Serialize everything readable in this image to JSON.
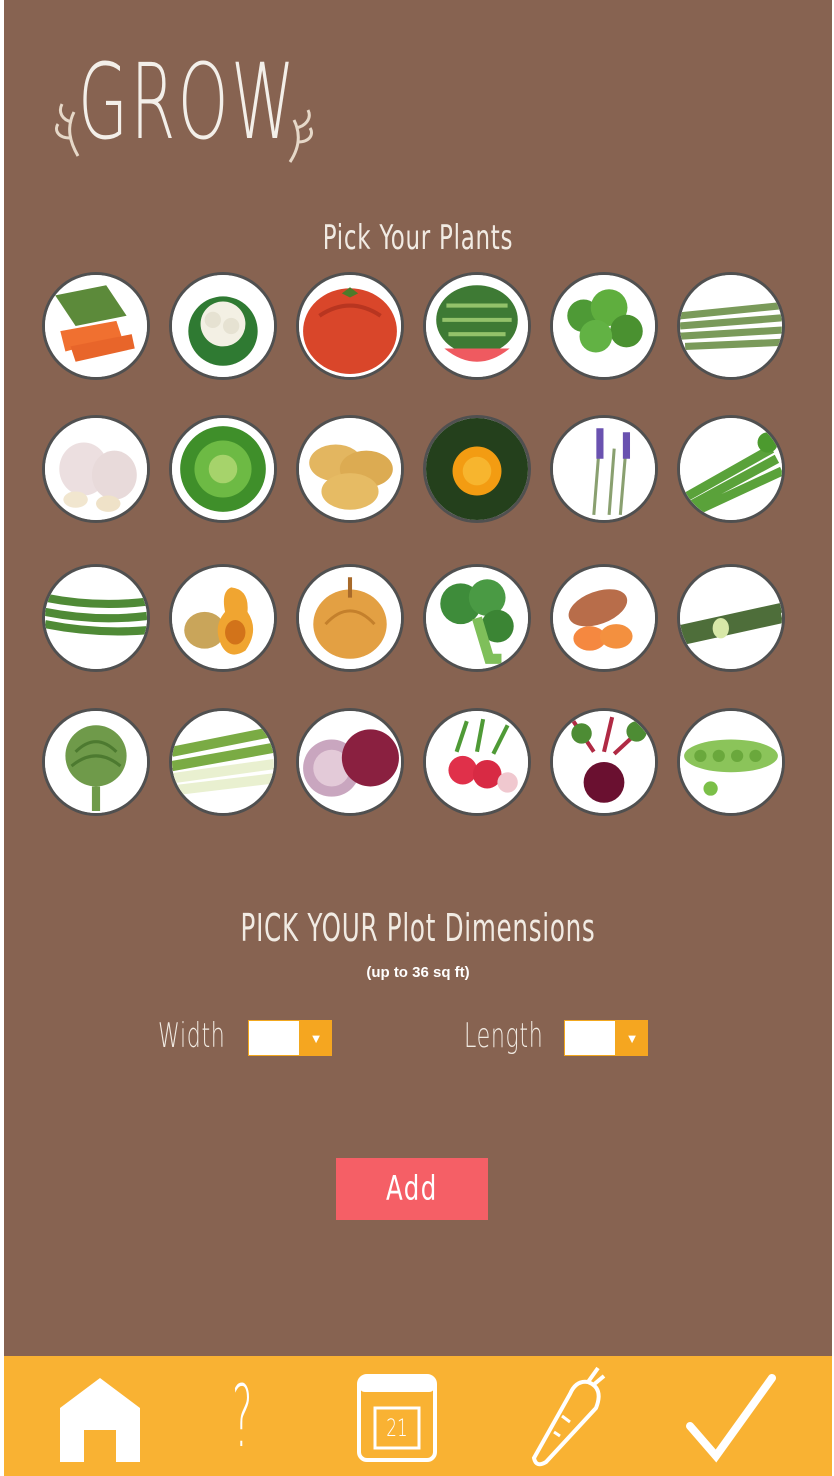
{
  "app": {
    "title": "GROW"
  },
  "plants_section": {
    "title": "Pick Your Plants",
    "plants": [
      {
        "name": "carrot",
        "icon": "carrot-photo"
      },
      {
        "name": "cauliflower",
        "icon": "cauliflower-photo"
      },
      {
        "name": "tomato",
        "icon": "tomato-photo"
      },
      {
        "name": "watermelon",
        "icon": "watermelon-photo"
      },
      {
        "name": "parsley",
        "icon": "parsley-photo"
      },
      {
        "name": "asparagus",
        "icon": "asparagus-photo"
      },
      {
        "name": "garlic",
        "icon": "garlic-photo"
      },
      {
        "name": "lettuce",
        "icon": "lettuce-photo"
      },
      {
        "name": "potato",
        "icon": "potato-photo"
      },
      {
        "name": "marigold",
        "icon": "marigold-photo"
      },
      {
        "name": "lavender",
        "icon": "lavender-photo"
      },
      {
        "name": "celery",
        "icon": "celery-photo"
      },
      {
        "name": "green-beans",
        "icon": "green-beans-photo"
      },
      {
        "name": "butternut-squash",
        "icon": "squash-photo"
      },
      {
        "name": "onion",
        "icon": "onion-photo"
      },
      {
        "name": "broccoli",
        "icon": "broccoli-photo"
      },
      {
        "name": "sweet-potato",
        "icon": "sweet-potato-photo"
      },
      {
        "name": "zucchini",
        "icon": "zucchini-photo"
      },
      {
        "name": "artichoke",
        "icon": "artichoke-photo"
      },
      {
        "name": "leek",
        "icon": "leek-photo"
      },
      {
        "name": "red-onion",
        "icon": "red-onion-photo"
      },
      {
        "name": "radish",
        "icon": "radish-photo"
      },
      {
        "name": "beet",
        "icon": "beet-photo"
      },
      {
        "name": "peas",
        "icon": "peas-photo"
      }
    ]
  },
  "dimensions_section": {
    "title": "PICK YOUR Plot Dimensions",
    "subtitle": "(up to 36 sq ft)",
    "width_label": "Width",
    "length_label": "Length",
    "width_value": "",
    "length_value": ""
  },
  "add_button": {
    "label": "Add"
  },
  "tab_bar": {
    "tabs": [
      {
        "name": "home",
        "icon": "home-icon"
      },
      {
        "name": "help",
        "icon": "question-icon",
        "label": "?"
      },
      {
        "name": "calendar",
        "icon": "calendar-icon",
        "label": "21"
      },
      {
        "name": "plants",
        "icon": "carrot-icon"
      },
      {
        "name": "done",
        "icon": "check-icon"
      }
    ]
  },
  "colors": {
    "background": "#876351",
    "tab_bar": "#f9b233",
    "add_button": "#f55f66",
    "select_arrow": "#f5a620"
  }
}
